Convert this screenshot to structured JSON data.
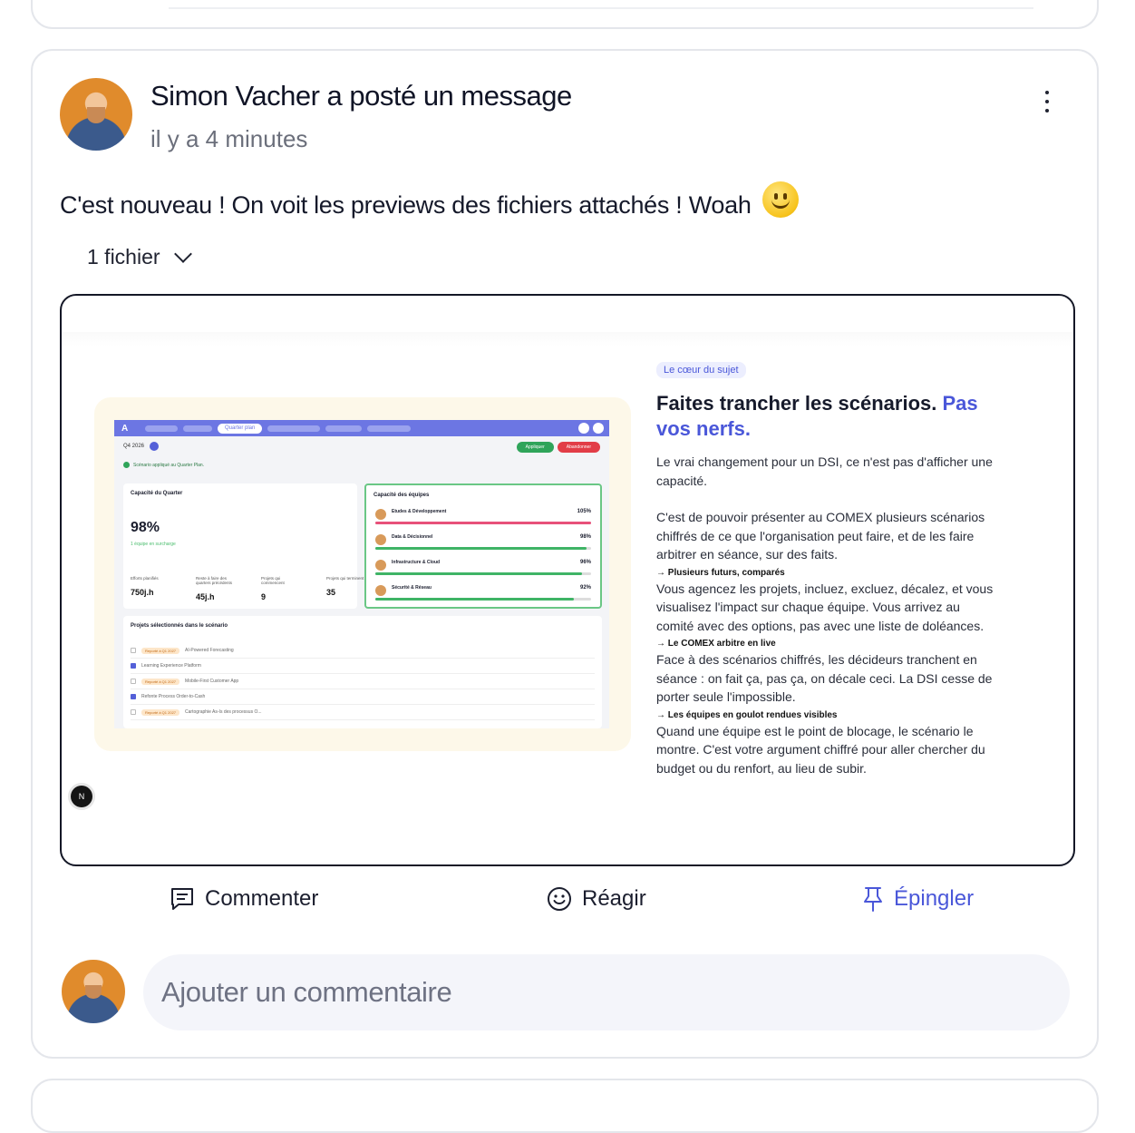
{
  "post": {
    "title": "Simon Vacher a posté un message",
    "time": "il y a 4 minutes",
    "message": "C'est nouveau ! On voit les previews des fichiers attachés ! Woah",
    "emoji_icon": "slightly-smiling-face-icon",
    "files_toggle": "1 fichier"
  },
  "preview": {
    "mock": {
      "nav_active": "Quarter plan",
      "quarter": "Q4 2026",
      "apply": "Appliquer",
      "abandon": "Abandonner",
      "alert": "Scénario appliqué au Quarter Plan.",
      "capacity_title": "Capacité du Quarter",
      "capacity_value": "98%",
      "capacity_note": "1 équipe en surcharge",
      "stats": [
        {
          "label": "Efforts planifiés",
          "value": "750j.h"
        },
        {
          "label": "Reste à faire des quarters précédents",
          "value": "45j.h"
        },
        {
          "label": "Projets qui commencent",
          "value": "9"
        },
        {
          "label": "Projets qui terminent",
          "value": "35"
        }
      ],
      "teams_title": "Capacité des équipes",
      "teams": [
        {
          "name": "Etudes & Développement",
          "pct": "105%",
          "fill": 1.0,
          "color": "#e8517a"
        },
        {
          "name": "Data & Décisionnel",
          "pct": "98%",
          "fill": 0.98,
          "color": "#3fb466"
        },
        {
          "name": "Infrastructure & Cloud",
          "pct": "96%",
          "fill": 0.96,
          "color": "#3fb466"
        },
        {
          "name": "Sécurité & Réseau",
          "pct": "92%",
          "fill": 0.92,
          "color": "#3fb466"
        }
      ],
      "projects_title": "Projets sélectionnés dans le scénario",
      "projects": [
        {
          "tag": "Reporté à Q1 2027",
          "name": "AI-Powered Forecasting",
          "checked": false
        },
        {
          "tag": "",
          "name": "Learning Experience Platform",
          "checked": true
        },
        {
          "tag": "Reporté à Q1 2027",
          "name": "Mobile-First Customer App",
          "checked": false
        },
        {
          "tag": "",
          "name": "Refonte Process Order-to-Cash",
          "checked": true
        },
        {
          "tag": "Reporté à Q1 2027",
          "name": "Cartographie As-Is des processus O...",
          "checked": false
        }
      ]
    },
    "badge": "Le cœur du sujet",
    "headline": "Faites trancher les scénarios.",
    "headline_accent": "Pas vos nerfs.",
    "intro": "Le vrai changement pour un DSI, ce n'est pas d'afficher une capacité.",
    "intro2": "C'est de pouvoir présenter au COMEX plusieurs scénarios chiffrés de ce que l'organisation peut faire, et de les faire arbitrer en séance, sur des faits.",
    "sections": [
      {
        "title": "→ Plusieurs futurs, comparés",
        "body": "Vous agencez les projets, incluez, excluez, décalez, et vous visualisez l'impact sur chaque équipe. Vous arrivez au comité avec des options, pas avec une liste de doléances."
      },
      {
        "title": "→ Le COMEX arbitre en live",
        "body": "Face à des scénarios chiffrés, les décideurs tranchent en séance : on fait ça, pas ça, on décale ceci. La DSI cesse de porter seule l'impossible."
      },
      {
        "title": "→ Les équipes en goulot rendues visibles",
        "body": "Quand une équipe est le point de blocage, le scénario le montre. C'est votre argument chiffré pour aller chercher du budget ou du renfort, au lieu de subir."
      }
    ],
    "n_badge": "N"
  },
  "actions": {
    "comment": "Commenter",
    "react": "Réagir",
    "pin": "Épingler"
  },
  "comment_box": {
    "placeholder": "Ajouter un commentaire"
  }
}
